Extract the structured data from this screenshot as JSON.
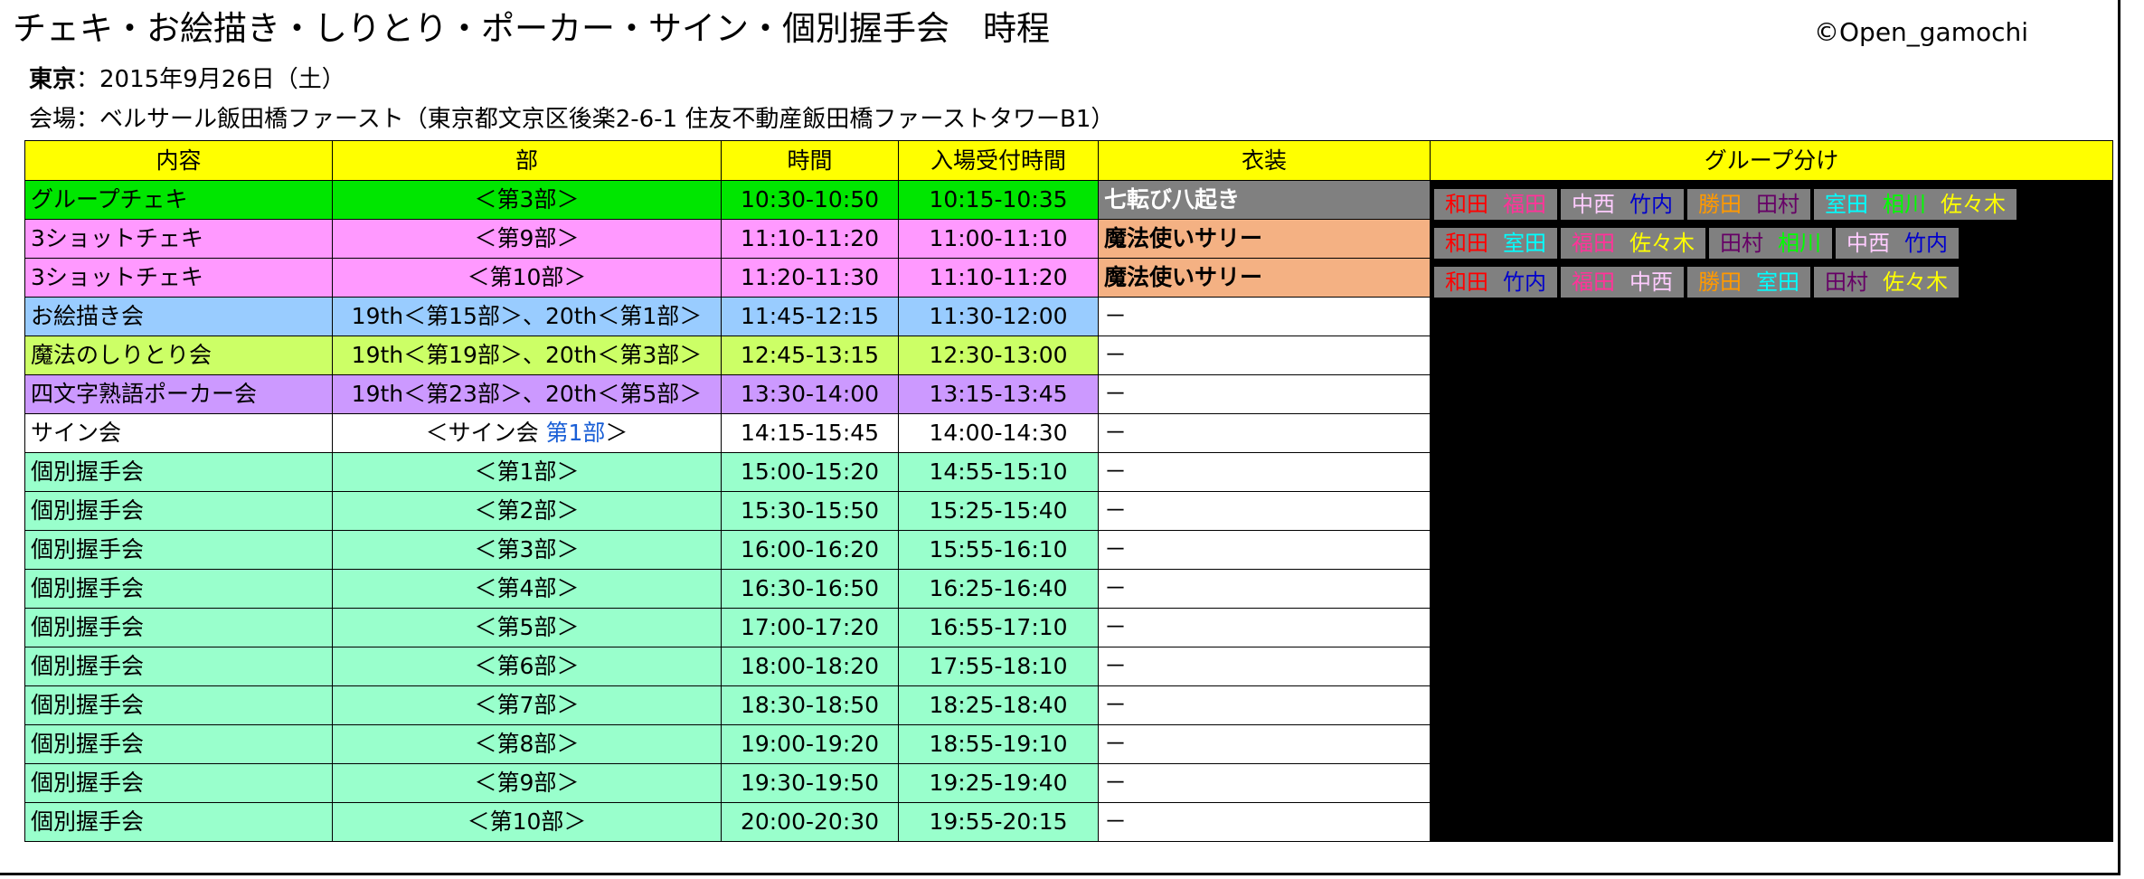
{
  "title": "チェキ・お絵描き・しりとり・ポーカー・サイン・個別握手会　時程",
  "copyright": "©Open_gamochi",
  "location_label": "東京",
  "date_text": "：2015年9月26日（土）",
  "venue_text": "会場：ベルサール飯田橋ファースト（東京都文京区後楽2-6-1 住友不動産飯田橋ファーストタワーB1）",
  "headers": {
    "content": "内容",
    "part": "部",
    "time": "時間",
    "reception": "入場受付時間",
    "costume": "衣装",
    "group": "グループ分け"
  },
  "rows": [
    {
      "content": "グループチェキ",
      "part": "＜第3部＞",
      "time": "10:30-10:50",
      "reception": "10:15-10:35",
      "costume": "七転び八起き"
    },
    {
      "content": "3ショットチェキ",
      "part": "＜第9部＞",
      "time": "11:10-11:20",
      "reception": "11:00-11:10",
      "costume": "魔法使いサリー"
    },
    {
      "content": "3ショットチェキ",
      "part": "＜第10部＞",
      "time": "11:20-11:30",
      "reception": "11:10-11:20",
      "costume": "魔法使いサリー"
    },
    {
      "content": "お絵描き会",
      "part": "19th＜第15部＞、20th＜第1部＞",
      "time": "11:45-12:15",
      "reception": "11:30-12:00",
      "costume": "－"
    },
    {
      "content": "魔法のしりとり会",
      "part": "19th＜第19部＞、20th＜第3部＞",
      "time": "12:45-13:15",
      "reception": "12:30-13:00",
      "costume": "－"
    },
    {
      "content": "四文字熟語ポーカー会",
      "part": "19th＜第23部＞、20th＜第5部＞",
      "time": "13:30-14:00",
      "reception": "13:15-13:45",
      "costume": "－"
    },
    {
      "content": "サイン会",
      "part_prefix": "＜サイン会 ",
      "part_link": "第1部",
      "part_suffix": "＞",
      "time": "14:15-15:45",
      "reception": "14:00-14:30",
      "costume": "－"
    },
    {
      "content": "個別握手会",
      "part": "＜第1部＞",
      "time": "15:00-15:20",
      "reception": "14:55-15:10",
      "costume": "－"
    },
    {
      "content": "個別握手会",
      "part": "＜第2部＞",
      "time": "15:30-15:50",
      "reception": "15:25-15:40",
      "costume": "－"
    },
    {
      "content": "個別握手会",
      "part": "＜第3部＞",
      "time": "16:00-16:20",
      "reception": "15:55-16:10",
      "costume": "－"
    },
    {
      "content": "個別握手会",
      "part": "＜第4部＞",
      "time": "16:30-16:50",
      "reception": "16:25-16:40",
      "costume": "－"
    },
    {
      "content": "個別握手会",
      "part": "＜第5部＞",
      "time": "17:00-17:20",
      "reception": "16:55-17:10",
      "costume": "－"
    },
    {
      "content": "個別握手会",
      "part": "＜第6部＞",
      "time": "18:00-18:20",
      "reception": "17:55-18:10",
      "costume": "－"
    },
    {
      "content": "個別握手会",
      "part": "＜第7部＞",
      "time": "18:30-18:50",
      "reception": "18:25-18:40",
      "costume": "－"
    },
    {
      "content": "個別握手会",
      "part": "＜第8部＞",
      "time": "19:00-19:20",
      "reception": "18:55-19:10",
      "costume": "－"
    },
    {
      "content": "個別握手会",
      "part": "＜第9部＞",
      "time": "19:30-19:50",
      "reception": "19:25-19:40",
      "costume": "－"
    },
    {
      "content": "個別握手会",
      "part": "＜第10部＞",
      "time": "20:00-20:30",
      "reception": "19:55-20:15",
      "costume": "－"
    }
  ],
  "groups": {
    "row0": [
      [
        {
          "name": "和田",
          "color": "#ff0000"
        },
        {
          "name": "福田",
          "color": "#ff3399"
        }
      ],
      [
        {
          "name": "中西",
          "color": "#ffccff"
        },
        {
          "name": "竹内",
          "color": "#0000cc"
        }
      ],
      [
        {
          "name": "勝田",
          "color": "#ff9900"
        },
        {
          "name": "田村",
          "color": "#660066"
        }
      ],
      [
        {
          "name": "室田",
          "color": "#00ffff"
        },
        {
          "name": "相川",
          "color": "#00ff00"
        },
        {
          "name": "佐々木",
          "color": "#ffff00"
        }
      ]
    ],
    "row1": [
      [
        {
          "name": "和田",
          "color": "#ff0000"
        },
        {
          "name": "室田",
          "color": "#00ffff"
        }
      ],
      [
        {
          "name": "福田",
          "color": "#ff3399"
        },
        {
          "name": "佐々木",
          "color": "#ffff00"
        }
      ],
      [
        {
          "name": "田村",
          "color": "#660066"
        },
        {
          "name": "相川",
          "color": "#00ff00"
        }
      ],
      [
        {
          "name": "中西",
          "color": "#ffccff"
        },
        {
          "name": "竹内",
          "color": "#0000cc"
        }
      ]
    ],
    "row2": [
      [
        {
          "name": "和田",
          "color": "#ff0000"
        },
        {
          "name": "竹内",
          "color": "#0000cc"
        }
      ],
      [
        {
          "name": "福田",
          "color": "#ff3399"
        },
        {
          "name": "中西",
          "color": "#ffccff"
        }
      ],
      [
        {
          "name": "勝田",
          "color": "#ff9900"
        },
        {
          "name": "室田",
          "color": "#00ffff"
        }
      ],
      [
        {
          "name": "田村",
          "color": "#660066"
        },
        {
          "name": "佐々木",
          "color": "#ffff00"
        }
      ]
    ]
  },
  "colors": {
    "header": "#ffff00",
    "group_cheki": "#00e600",
    "three_shot": "#ff99ff",
    "oekaki": "#99ccff",
    "shiritori": "#ccff66",
    "poker": "#cc99ff",
    "sign": "#ffffff",
    "handshake": "#99ffcc",
    "costume_gray": "#808080",
    "costume_orange": "#f4b183",
    "group_bg": "#000000"
  }
}
